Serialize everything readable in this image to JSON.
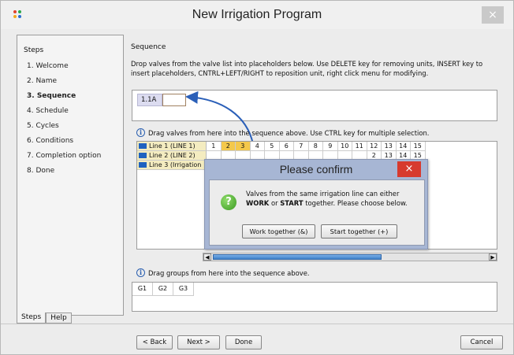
{
  "window": {
    "title": "New Irrigation Program",
    "close_glyph": "×"
  },
  "steps_panel": {
    "heading": "Steps",
    "items": [
      {
        "label": "1.  Welcome"
      },
      {
        "label": "2.  Name"
      },
      {
        "label": "3.  Sequence"
      },
      {
        "label": "4.  Schedule"
      },
      {
        "label": "5.  Cycles"
      },
      {
        "label": "6.  Conditions"
      },
      {
        "label": "7.  Completion option"
      },
      {
        "label": "8.  Done"
      }
    ],
    "active_index": 2,
    "tabs": [
      {
        "label": "Steps"
      },
      {
        "label": "Help"
      }
    ]
  },
  "sequence": {
    "title": "Sequence",
    "description": "Drop valves from the valve list into placeholders below. Use DELETE key for removing units, INSERT key to insert placeholders, CNTRL+LEFT/RIGHT to reposition unit, right click menu for modifying.",
    "chip": "1.1A"
  },
  "valves": {
    "hint": "Drag valves from here into the sequence above. Use CTRL key for multiple selection.",
    "lines": [
      {
        "label": "Line 1 (LINE  1)",
        "cells": [
          "1",
          "2",
          "3",
          "4",
          "5",
          "6",
          "7",
          "8",
          "9",
          "10",
          "11",
          "12",
          "13",
          "14",
          "15"
        ],
        "selected": [
          1,
          2
        ]
      },
      {
        "label": "Line 2 (LINE  2)",
        "cells": [
          "",
          "",
          "",
          "",
          "",
          "",
          "",
          "",
          "",
          "",
          "",
          "2",
          "13",
          "14",
          "15"
        ],
        "selected": []
      },
      {
        "label": "Line 3 (Irrigation",
        "cells": [],
        "selected": []
      }
    ],
    "line_color": "#1f62c0"
  },
  "groups": {
    "hint": "Drag groups from here into the sequence above.",
    "items": [
      "G1",
      "G2",
      "G3"
    ]
  },
  "footer": {
    "back": "< Back",
    "next": "Next >",
    "done": "Done",
    "cancel": "Cancel"
  },
  "dialog": {
    "title": "Please confirm",
    "close_glyph": "×",
    "message_line1": "Valves from the same irrigation line can either",
    "message_work": "WORK",
    "message_or": " or ",
    "message_start": "START",
    "message_tail": " together. Please choose below.",
    "work_button": "Work together (&)",
    "start_button": "Start together (+)",
    "accent": "#d73a2e"
  }
}
